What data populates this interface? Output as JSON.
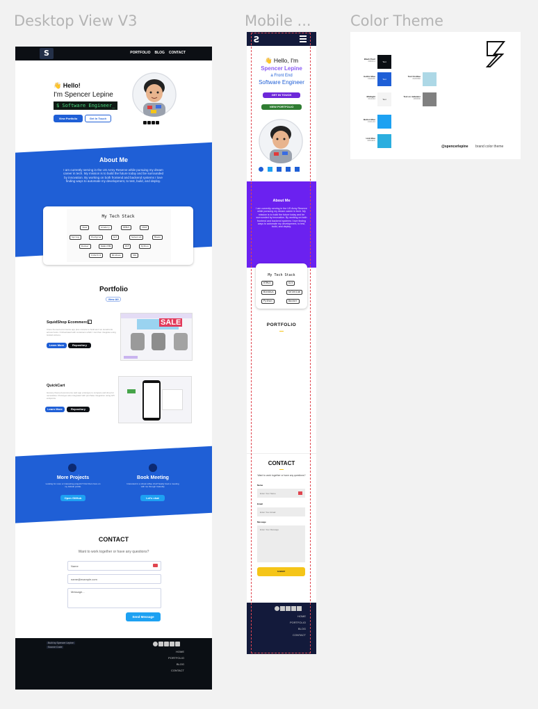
{
  "frames": {
    "desktop_title": "Desktop View V3",
    "mobile_title": "Mobile ...",
    "theme_title": "Color Theme"
  },
  "desktop": {
    "nav": {
      "logo": "S",
      "links": [
        "PORTFOLIO",
        "BLOG",
        "CONTACT"
      ]
    },
    "hero": {
      "hello": "👋 Hello!",
      "iam": "I'm Spencer Lepine",
      "role": "$ Software Engineer_",
      "btn_primary": "View Portfolio",
      "btn_secondary": "Get In Touch"
    },
    "about": {
      "title": "About Me",
      "body": "I am currently serving in the US Army Reserve while pursuing my dream career in tech. My mission is to build the future today and be surrounded by innovation. By working on both frontend and backend systems I love finding ways to automate my development, to test, build, and deploy."
    },
    "tech": {
      "title": "My Tech Stack",
      "rows": [
        [
          "Java",
          "Gradury",
          "HTML5",
          "CSS3"
        ],
        [
          "Spring",
          "Postgres",
          "Git",
          "Selenium",
          "Maven"
        ],
        [
          "Docker",
          "RabbitMQ",
          "PCF",
          "Python"
        ],
        [
          "IntelliJ",
          "Windows",
          "SQL"
        ]
      ]
    },
    "portfolio": {
      "title": "Portfolio",
      "view_all": "View All",
      "projects": [
        {
          "name": "SquidShop Ecommerce",
          "desc": "Clone themed ecommerce app plus console to build and run storefronts across hosts. Orchestrated with containers which I can then integrate using GitHub Actions.",
          "learn": "Learn More",
          "repo": "Repository",
          "banner": "SALE"
        },
        {
          "name": "QuickCart",
          "desc": "Grocery themed ecommerce web app prototype to compare and shop for necessities. Prototype also integrated with purchase integration using API endpoints.",
          "learn": "Learn More",
          "repo": "Repository"
        }
      ]
    },
    "cta": {
      "left_title": "More Projects",
      "left_text": "Looking for more or interesting projects? Find them here on my GitHub profile.",
      "left_btn": "Open GitHub",
      "right_title": "Book Meeting",
      "right_text": "Interested in a virtual coffee chat? Easily book a meeting with me through Calendly.",
      "right_btn": "Let's chat"
    },
    "contact": {
      "title": "CONTACT",
      "subtitle": "Want to work together or have any questions?",
      "name_placeholder": "Name",
      "email_placeholder": "name@example.com",
      "message_placeholder": "Message...",
      "send": "Send Message"
    },
    "footer": {
      "built": "Built by Spencer Lepine",
      "source": "Source Code",
      "links": [
        "HOME",
        "PORTFOLIO",
        "BLOG",
        "CONTACT"
      ]
    }
  },
  "mobile": {
    "hero": {
      "hello": "👋 Hello, I'm",
      "name": "Spencer Lepine",
      "a_front": "a Front End",
      "role": "Software Engineer",
      "btn_touch": "GET IN TOUCH",
      "btn_portfolio": "VIEW PORTFOLIO"
    },
    "about": {
      "title": "About Me",
      "body": "I am currently serving in the US Army Reserve while pursuing my dream career in tech. My mission is to build the future today and be surrounded by innovation. By working on both frontend and backend systems I love finding ways to automate my development, to test, build, and deploy."
    },
    "tech": {
      "title": "My Tech Stack",
      "chips": [
        "HTML5",
        "Git",
        "Windows",
        "Selenium",
        "Python",
        "Docker"
      ]
    },
    "portfolio_title": "PORTFOLIO",
    "contact": {
      "title": "CONTACT",
      "subtitle": "Want to work together or have any questions?",
      "name_label": "Name",
      "name_placeholder": "Enter Your Name",
      "email_label": "Email",
      "email_placeholder": "Enter Your Email",
      "message_label": "Message",
      "message_placeholder": "Enter Your Message",
      "submit": "SUBMIT"
    },
    "footer_links": [
      "HOME",
      "PORTFOLIO",
      "BLOG",
      "CONTACT"
    ]
  },
  "theme": {
    "swatches": [
      {
        "name": "Black Pearl",
        "hex": "#0B0F14",
        "color": "#0b0f14",
        "inner": "Text"
      },
      {
        "name": "Gothic Blue",
        "hex": "#1E40AF",
        "color": "#1f5fd6",
        "inner": "Text"
      },
      {
        "name": "Midnight",
        "hex": "#F4F4F4",
        "color": "#f4f4f4",
        "inner": "Text"
      },
      {
        "name": "Button Blue",
        "hex": "#1DA1F2",
        "color": "#1da1f2",
        "inner": ""
      },
      {
        "name": "Link Blue",
        "hex": "#2BAEDF",
        "color": "#2baedf",
        "inner": ""
      },
      {
        "name": "Text On Blue",
        "hex": "#ADD8E6",
        "color": "#add8e6",
        "inner": ""
      },
      {
        "name": "Text on midwater",
        "hex": "#808080",
        "color": "#808080",
        "inner": ""
      }
    ],
    "handle": "@spencerlepine",
    "caption": "brand color theme"
  },
  "colors": {
    "brand_blue": "#1f5fd6",
    "mobile_purple": "#6b21f0",
    "navy": "#131a3b",
    "yellow": "#f5c518"
  }
}
